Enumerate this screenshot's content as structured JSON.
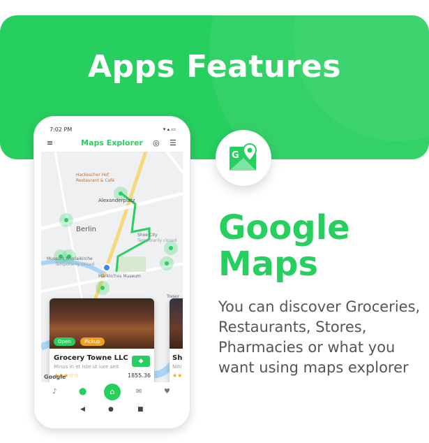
{
  "banner": {
    "headline": "Apps Features"
  },
  "feature": {
    "title": "Google Maps",
    "description": "You can discover Groceries,  Restaurants, Stores, Pharmacies or what you want using maps explorer"
  },
  "phone": {
    "status_time": "7:02 PM",
    "app_title": "Maps Explorer",
    "map_labels": {
      "poi1": "Hackescher Hof",
      "poi1b": "Restaurant & Café",
      "poi2": "Alexanderplatz",
      "city": "Berlin",
      "poi3": "Shoe City",
      "poi3b": "Temporarily closed",
      "poi4": "Museum Nikolaikirche",
      "poi4b": "Temporarily closed",
      "poi5": "Märkisches Museum",
      "street1": "Tresor"
    },
    "card": {
      "tag_open": "Open",
      "tag_pickup": "Pickup",
      "name": "Grocery Towne LLC",
      "subtitle": "Minus in et iste ut iure sed",
      "stars": "★★★☆☆",
      "distance": "1855.36"
    },
    "card2": {
      "name": "She",
      "subtitle": "Nihi",
      "stars": "★★"
    },
    "attribution": "Google",
    "colors": {
      "accent": "#27cf5f"
    }
  }
}
